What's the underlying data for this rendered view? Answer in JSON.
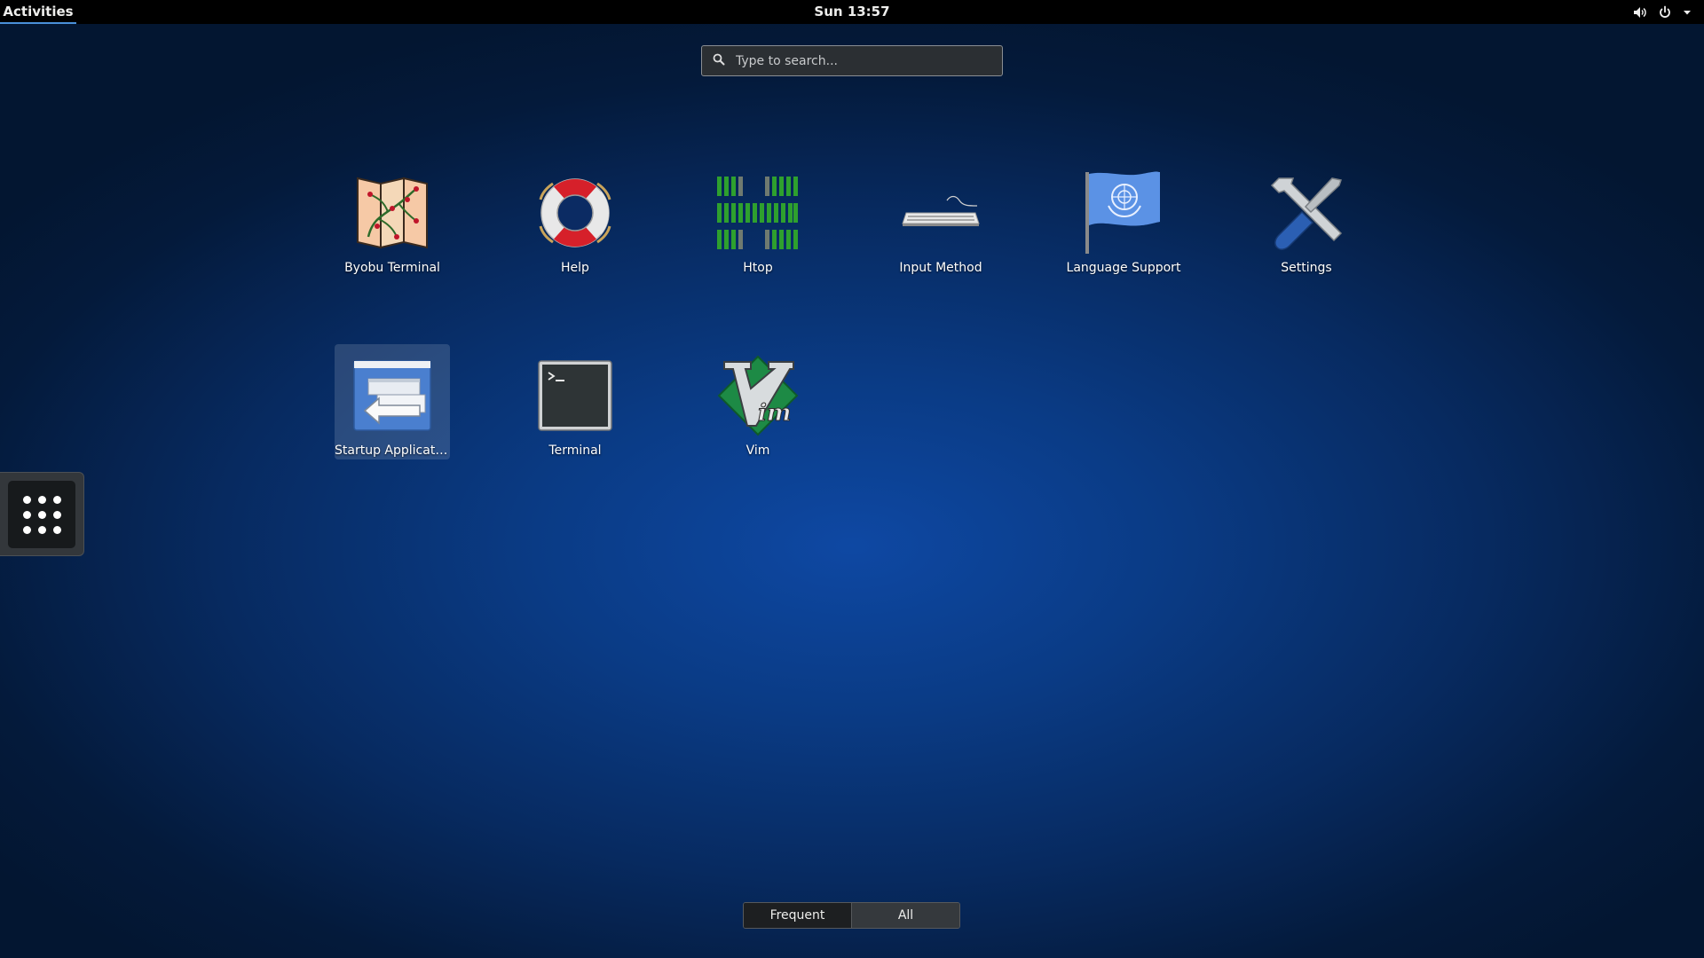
{
  "topbar": {
    "activities": "Activities",
    "clock": "Sun 13:57",
    "icons": [
      "volume-icon",
      "power-icon",
      "dropdown-arrow-icon"
    ]
  },
  "search": {
    "placeholder": "Type to search..."
  },
  "apps": [
    {
      "label": "Byobu Terminal",
      "icon": "byobu-map-icon"
    },
    {
      "label": "Help",
      "icon": "lifebuoy-icon"
    },
    {
      "label": "Htop",
      "icon": "htop-bars-icon"
    },
    {
      "label": "Input Method",
      "icon": "keyboard-icon"
    },
    {
      "label": "Language Support",
      "icon": "un-flag-icon"
    },
    {
      "label": "Settings",
      "icon": "wrench-screwdriver-icon"
    },
    {
      "label": "Startup Applicati...",
      "icon": "startup-applications-icon",
      "selected": true
    },
    {
      "label": "Terminal",
      "icon": "terminal-icon"
    },
    {
      "label": "Vim",
      "icon": "vim-icon"
    }
  ],
  "view_toggle": {
    "frequent": "Frequent",
    "all": "All",
    "active": "all"
  },
  "colors": {
    "accent": "#4a90d9",
    "panel": "#000000",
    "htop_green": "#2ea02e",
    "vim_green": "#1d8a45"
  }
}
